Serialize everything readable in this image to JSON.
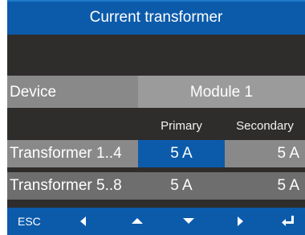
{
  "header": {
    "title": "Current transformer"
  },
  "device": {
    "label": "Device",
    "value": "Module 1"
  },
  "table": {
    "columns": [
      "Primary",
      "Secondary"
    ],
    "rows": [
      {
        "label": "Transformer 1..4",
        "primary": "5 A",
        "secondary": "5 A",
        "selected": "primary"
      },
      {
        "label": "Transformer 5..8",
        "primary": "5 A",
        "secondary": "5 A",
        "selected": null
      }
    ]
  },
  "softkeys": [
    {
      "label": "ESC",
      "icon": "esc"
    },
    {
      "label": "",
      "icon": "arrow-left-icon"
    },
    {
      "label": "",
      "icon": "arrow-up-icon"
    },
    {
      "label": "",
      "icon": "arrow-down-icon"
    },
    {
      "label": "",
      "icon": "arrow-right-icon"
    },
    {
      "label": "",
      "icon": "enter-icon"
    }
  ],
  "colors": {
    "accent": "#0c5bab",
    "background": "#2f2c2c",
    "row_light": "#898989",
    "row_dark": "#6e6e6e",
    "selected": "#0c5bab"
  }
}
